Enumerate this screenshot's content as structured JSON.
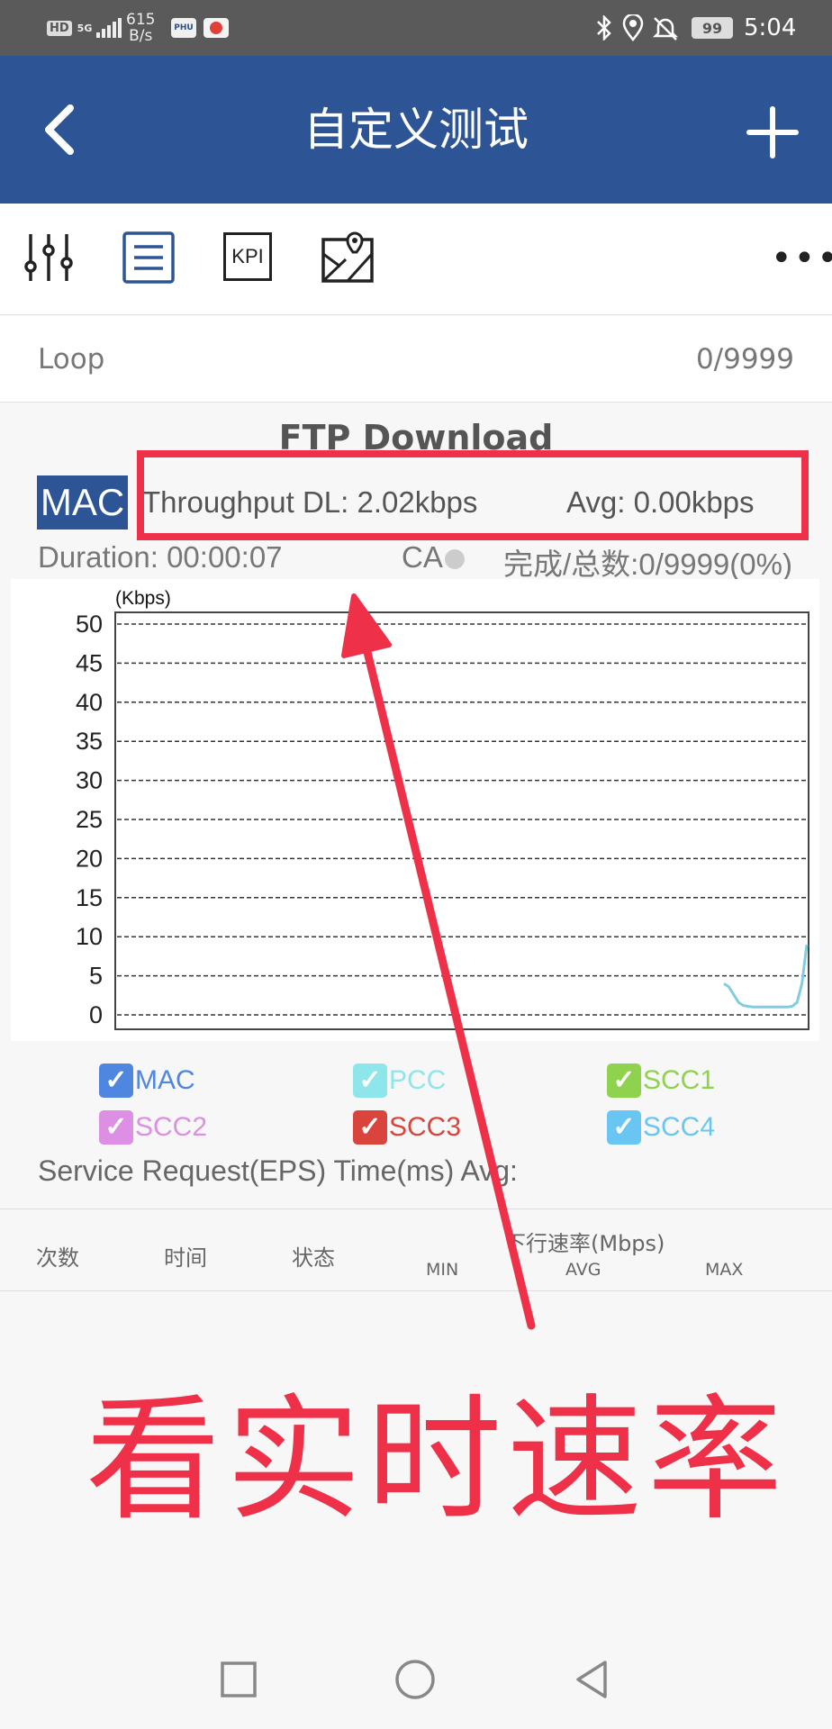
{
  "status_bar": {
    "hd": "HD",
    "signal": "5G",
    "net_speed_value": "615",
    "net_speed_unit": "B/s",
    "app_badge_1": "PHU",
    "battery": "99",
    "time": "5:04",
    "icons": [
      "bluetooth-icon",
      "location-icon",
      "mute-icon",
      "battery-icon"
    ]
  },
  "header": {
    "title": "自定义测试",
    "back_icon": "chevron-left-icon",
    "add_icon": "plus-icon"
  },
  "toolbar": {
    "items": [
      "sliders-icon",
      "list-icon",
      "kpi-icon",
      "map-icon"
    ],
    "kpi_label": "KPI",
    "more_label": "•••"
  },
  "loop": {
    "label": "Loop",
    "value": "0/9999"
  },
  "test": {
    "title": "FTP Download",
    "mode": "MAC",
    "throughput": "Throughput DL: 2.02kbps",
    "avg": "Avg: 0.00kbps",
    "duration": "Duration: 00:00:07",
    "ca": "CA",
    "progress": "完成/总数:0/9999(0%)"
  },
  "chart_data": {
    "type": "line",
    "ylabel": "(Kbps)",
    "ylim": [
      0,
      50
    ],
    "yticks": [
      "50",
      "45",
      "40",
      "35",
      "30",
      "25",
      "20",
      "15",
      "10",
      "5",
      "0"
    ],
    "grid": true,
    "series": [
      {
        "name": "MAC",
        "color": "#7fcde0",
        "values": [
          4,
          3.6,
          2.6,
          1.6,
          1.2,
          1.1,
          1.0,
          1.0,
          1.0,
          1.0,
          1.0,
          1.0,
          1.0,
          1.0,
          1.1,
          1.6,
          4.0,
          9.0
        ]
      }
    ]
  },
  "legend": [
    {
      "label": "MAC",
      "color": "#4f86e0"
    },
    {
      "label": "PCC",
      "color": "#8ee5ea"
    },
    {
      "label": "SCC1",
      "color": "#8ed24e"
    },
    {
      "label": "SCC2",
      "color": "#dd8fe3"
    },
    {
      "label": "SCC3",
      "color": "#d9453c"
    },
    {
      "label": "SCC4",
      "color": "#69c6f2"
    }
  ],
  "service": {
    "text": "Service Request(EPS) Time(ms) Avg:"
  },
  "table": {
    "col_count": "次数",
    "col_time": "时间",
    "col_status": "状态",
    "col_rate": "下行速率(Mbps)",
    "sub_min": "MIN",
    "sub_avg": "AVG",
    "sub_max": "MAX"
  },
  "annotation": {
    "text": "看实时速率",
    "color": "#ee3048"
  },
  "nav": {
    "icons": [
      "recents-square-icon",
      "home-circle-icon",
      "back-triangle-icon"
    ]
  }
}
